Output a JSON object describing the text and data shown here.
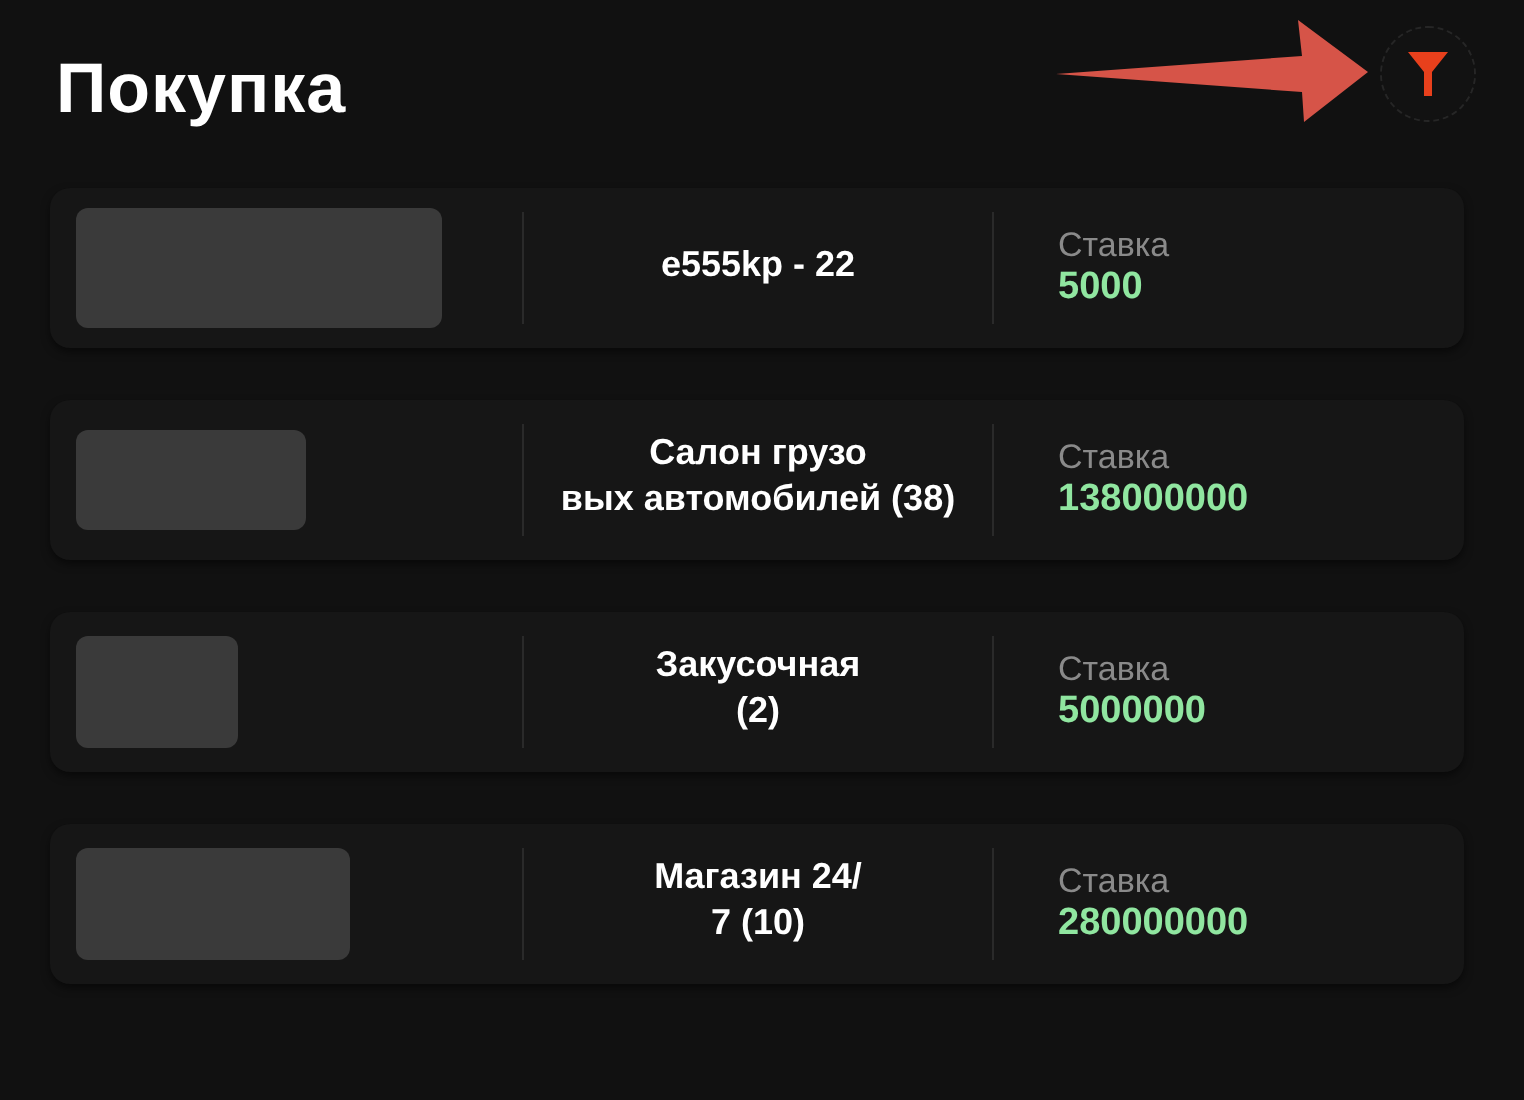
{
  "title": "Покупка",
  "items": [
    {
      "name_lines": [
        "e555kp - 22"
      ],
      "rate_label": "Ставка",
      "rate": "5000"
    },
    {
      "name_lines": [
        "Салон грузо",
        "вых автомобилей (38)"
      ],
      "rate_label": "Ставка",
      "rate": "138000000"
    },
    {
      "name_lines": [
        "Закусочная",
        "(2)"
      ],
      "rate_label": "Ставка",
      "rate": "5000000"
    },
    {
      "name_lines": [
        "Магазин 24/",
        "7 (10)"
      ],
      "rate_label": "Ставка",
      "rate": "280000000"
    }
  ]
}
